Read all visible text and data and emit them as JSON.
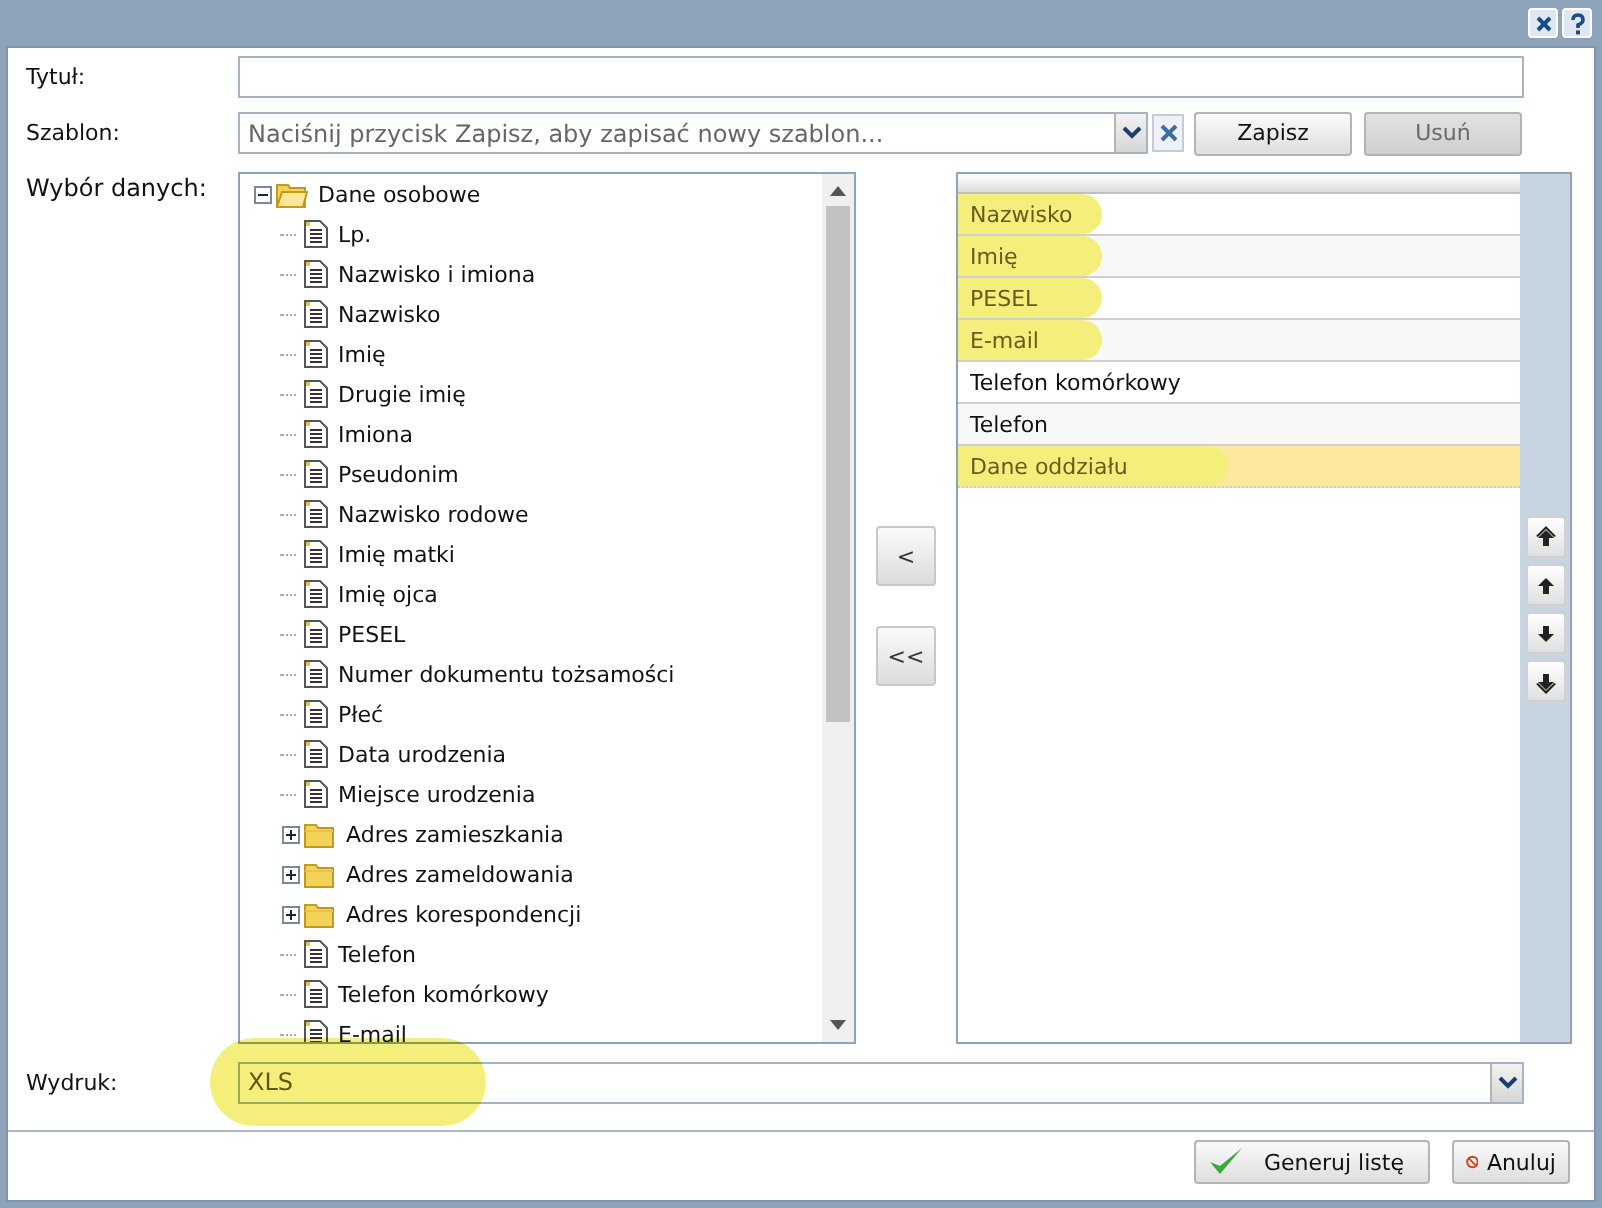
{
  "form": {
    "title_label": "Tytuł:",
    "template_label": "Szablon:",
    "template_placeholder": "Naciśnij przycisk Zapisz, aby zapisać nowy szablon...",
    "save_button": {
      "label": "Zapisz",
      "disabled": false
    },
    "delete_button": {
      "label": "Usuń",
      "disabled": true
    },
    "data_label": "Wybór danych:"
  },
  "tree": [
    {
      "label": "Dane osobowe",
      "kind": "folder",
      "expanded": true,
      "children": [
        {
          "label": "Lp.",
          "kind": "file"
        },
        {
          "label": "Nazwisko i imiona",
          "kind": "file"
        },
        {
          "label": "Nazwisko",
          "kind": "file"
        },
        {
          "label": "Imię",
          "kind": "file"
        },
        {
          "label": "Drugie imię",
          "kind": "file"
        },
        {
          "label": "Imiona",
          "kind": "file"
        },
        {
          "label": "Pseudonim",
          "kind": "file"
        },
        {
          "label": "Nazwisko rodowe",
          "kind": "file"
        },
        {
          "label": "Imię matki",
          "kind": "file"
        },
        {
          "label": "Imię ojca",
          "kind": "file"
        },
        {
          "label": "PESEL",
          "kind": "file"
        },
        {
          "label": "Numer dokumentu tożsamości",
          "kind": "file"
        },
        {
          "label": "Płeć",
          "kind": "file"
        },
        {
          "label": "Data urodzenia",
          "kind": "file"
        },
        {
          "label": "Miejsce urodzenia",
          "kind": "file"
        },
        {
          "label": "Adres zamieszkania",
          "kind": "folder",
          "expanded": false
        },
        {
          "label": "Adres zameldowania",
          "kind": "folder",
          "expanded": false
        },
        {
          "label": "Adres korespondencji",
          "kind": "folder",
          "expanded": false
        },
        {
          "label": "Telefon",
          "kind": "file"
        },
        {
          "label": "Telefon komórkowy",
          "kind": "file"
        },
        {
          "label": "E-mail",
          "kind": "file"
        }
      ]
    }
  ],
  "move_buttons": [
    "<",
    "<<"
  ],
  "selected_fields": [
    {
      "label": "Nazwisko",
      "selected": false,
      "highlighted": true
    },
    {
      "label": "Imię",
      "selected": false,
      "highlighted": true
    },
    {
      "label": "PESEL",
      "selected": false,
      "highlighted": true
    },
    {
      "label": "E-mail",
      "selected": false,
      "highlighted": true
    },
    {
      "label": "Telefon komórkowy",
      "selected": false,
      "highlighted": false
    },
    {
      "label": "Telefon",
      "selected": false,
      "highlighted": false
    },
    {
      "label": "Dane oddziału",
      "selected": true,
      "highlighted": true
    }
  ],
  "output": {
    "label": "Wydruk:",
    "value": "XLS",
    "highlighted": true
  },
  "footer": {
    "generate_button": "Generuj listę",
    "cancel_button": "Anuluj"
  }
}
